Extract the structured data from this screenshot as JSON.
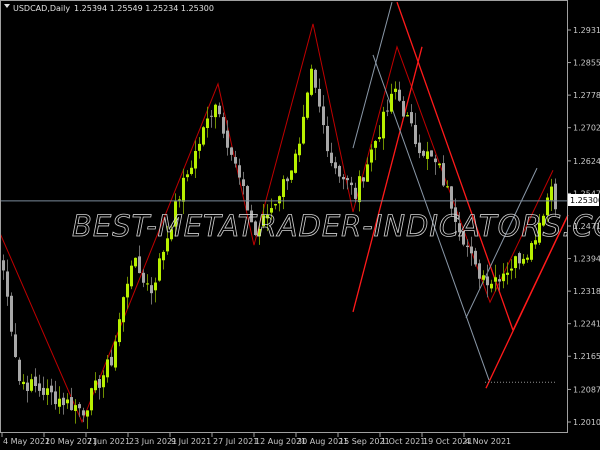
{
  "header": {
    "title": "USDCAD,Daily",
    "ohlc": "1.25394 1.25549 1.25234 1.25300"
  },
  "watermark": "BEST-METATRADER-INDICATORS.COM",
  "colors": {
    "background": "#000000",
    "bull": "#b8f000",
    "bear": "#a8a8a8",
    "zigzag": "#c00000",
    "channel_red": "#ff1a1a",
    "channel_gray": "#8a98a8",
    "price_line": "#7a8a9a",
    "axis": "#a0a0a0"
  },
  "chart_data": {
    "type": "candlestick",
    "symbol": "USDCAD",
    "timeframe": "Daily",
    "current_price": "1.25300",
    "current_price_value": 1.253,
    "ylim": [
      1.20105,
      1.29315
    ],
    "xlim_bars": [
      -0.75,
      141.5
    ],
    "y_ticks": [
      "1.29315",
      "1.28550",
      "1.27785",
      "1.27020",
      "1.26240",
      "1.25475",
      "1.24710",
      "1.23945",
      "1.23180",
      "1.22415",
      "1.21650",
      "1.20870",
      "1.20105"
    ],
    "x_ticks": [
      {
        "label": "4 May 2021",
        "bar": 0
      },
      {
        "label": "20 May 2021",
        "bar": 10.5
      },
      {
        "label": "7 Jun 2021",
        "bar": 21
      },
      {
        "label": "23 Jun 2021",
        "bar": 31.5
      },
      {
        "label": "9 Jul 2021",
        "bar": 42
      },
      {
        "label": "27 Jul 2021",
        "bar": 52.5
      },
      {
        "label": "12 Aug 2021",
        "bar": 63
      },
      {
        "label": "30 Aug 2021",
        "bar": 73.5
      },
      {
        "label": "15 Sep 2021",
        "bar": 84
      },
      {
        "label": "1 Oct 2021",
        "bar": 94.5
      },
      {
        "label": "19 Oct 2021",
        "bar": 105
      },
      {
        "label": "4 Nov 2021",
        "bar": 115.5
      }
    ],
    "close_path": [
      [
        0,
        1.2367
      ],
      [
        4,
        1.2109
      ],
      [
        12,
        1.2074
      ],
      [
        20,
        1.2039
      ],
      [
        27,
        1.2156
      ],
      [
        32,
        1.2391
      ],
      [
        37,
        1.232
      ],
      [
        44,
        1.2544
      ],
      [
        53,
        1.2767
      ],
      [
        59,
        1.2579
      ],
      [
        63,
        1.245
      ],
      [
        68,
        1.2532
      ],
      [
        74,
        1.265
      ],
      [
        77,
        1.2826
      ],
      [
        82,
        1.2626
      ],
      [
        88,
        1.2544
      ],
      [
        93,
        1.2673
      ],
      [
        98,
        1.279
      ],
      [
        103,
        1.2673
      ],
      [
        109,
        1.2603
      ],
      [
        114,
        1.2473
      ],
      [
        118,
        1.2367
      ],
      [
        122,
        1.2344
      ],
      [
        127,
        1.2379
      ],
      [
        132,
        1.2426
      ],
      [
        137,
        1.2567
      ],
      [
        138,
        1.253
      ]
    ],
    "zigzag": [
      [
        -0.75,
        1.2454
      ],
      [
        19.75,
        1.20105
      ],
      [
        53.75,
        1.2805
      ],
      [
        62.75,
        1.2426
      ],
      [
        77.5,
        1.2946
      ],
      [
        87.5,
        1.2504
      ],
      [
        98.5,
        1.2892
      ],
      [
        121.75,
        1.2292
      ],
      [
        137.5,
        1.2602
      ]
    ],
    "red_lines": [
      [
        [
          87.5,
          1.2269
        ],
        [
          104.75,
          1.2892
        ]
      ],
      [
        [
          98.5,
          1.2997
        ],
        [
          127.5,
          1.2226
        ]
      ],
      [
        [
          127.5,
          1.2226
        ],
        [
          141.25,
          1.2497
        ]
      ],
      [
        [
          120.75,
          1.209
        ],
        [
          141,
          1.2492
        ]
      ]
    ],
    "gray_lines": [
      [
        [
          87.5,
          1.2654
        ],
        [
          97.25,
          1.2997
        ]
      ],
      [
        [
          92.5,
          1.2873
        ],
        [
          121.5,
          1.2109
        ]
      ],
      [
        [
          115.75,
          1.2255
        ],
        [
          133.5,
          1.2607
        ]
      ]
    ],
    "dotted_level": {
      "price": 1.2104,
      "from_bar": 120.5,
      "to_bar": 138.5
    }
  }
}
